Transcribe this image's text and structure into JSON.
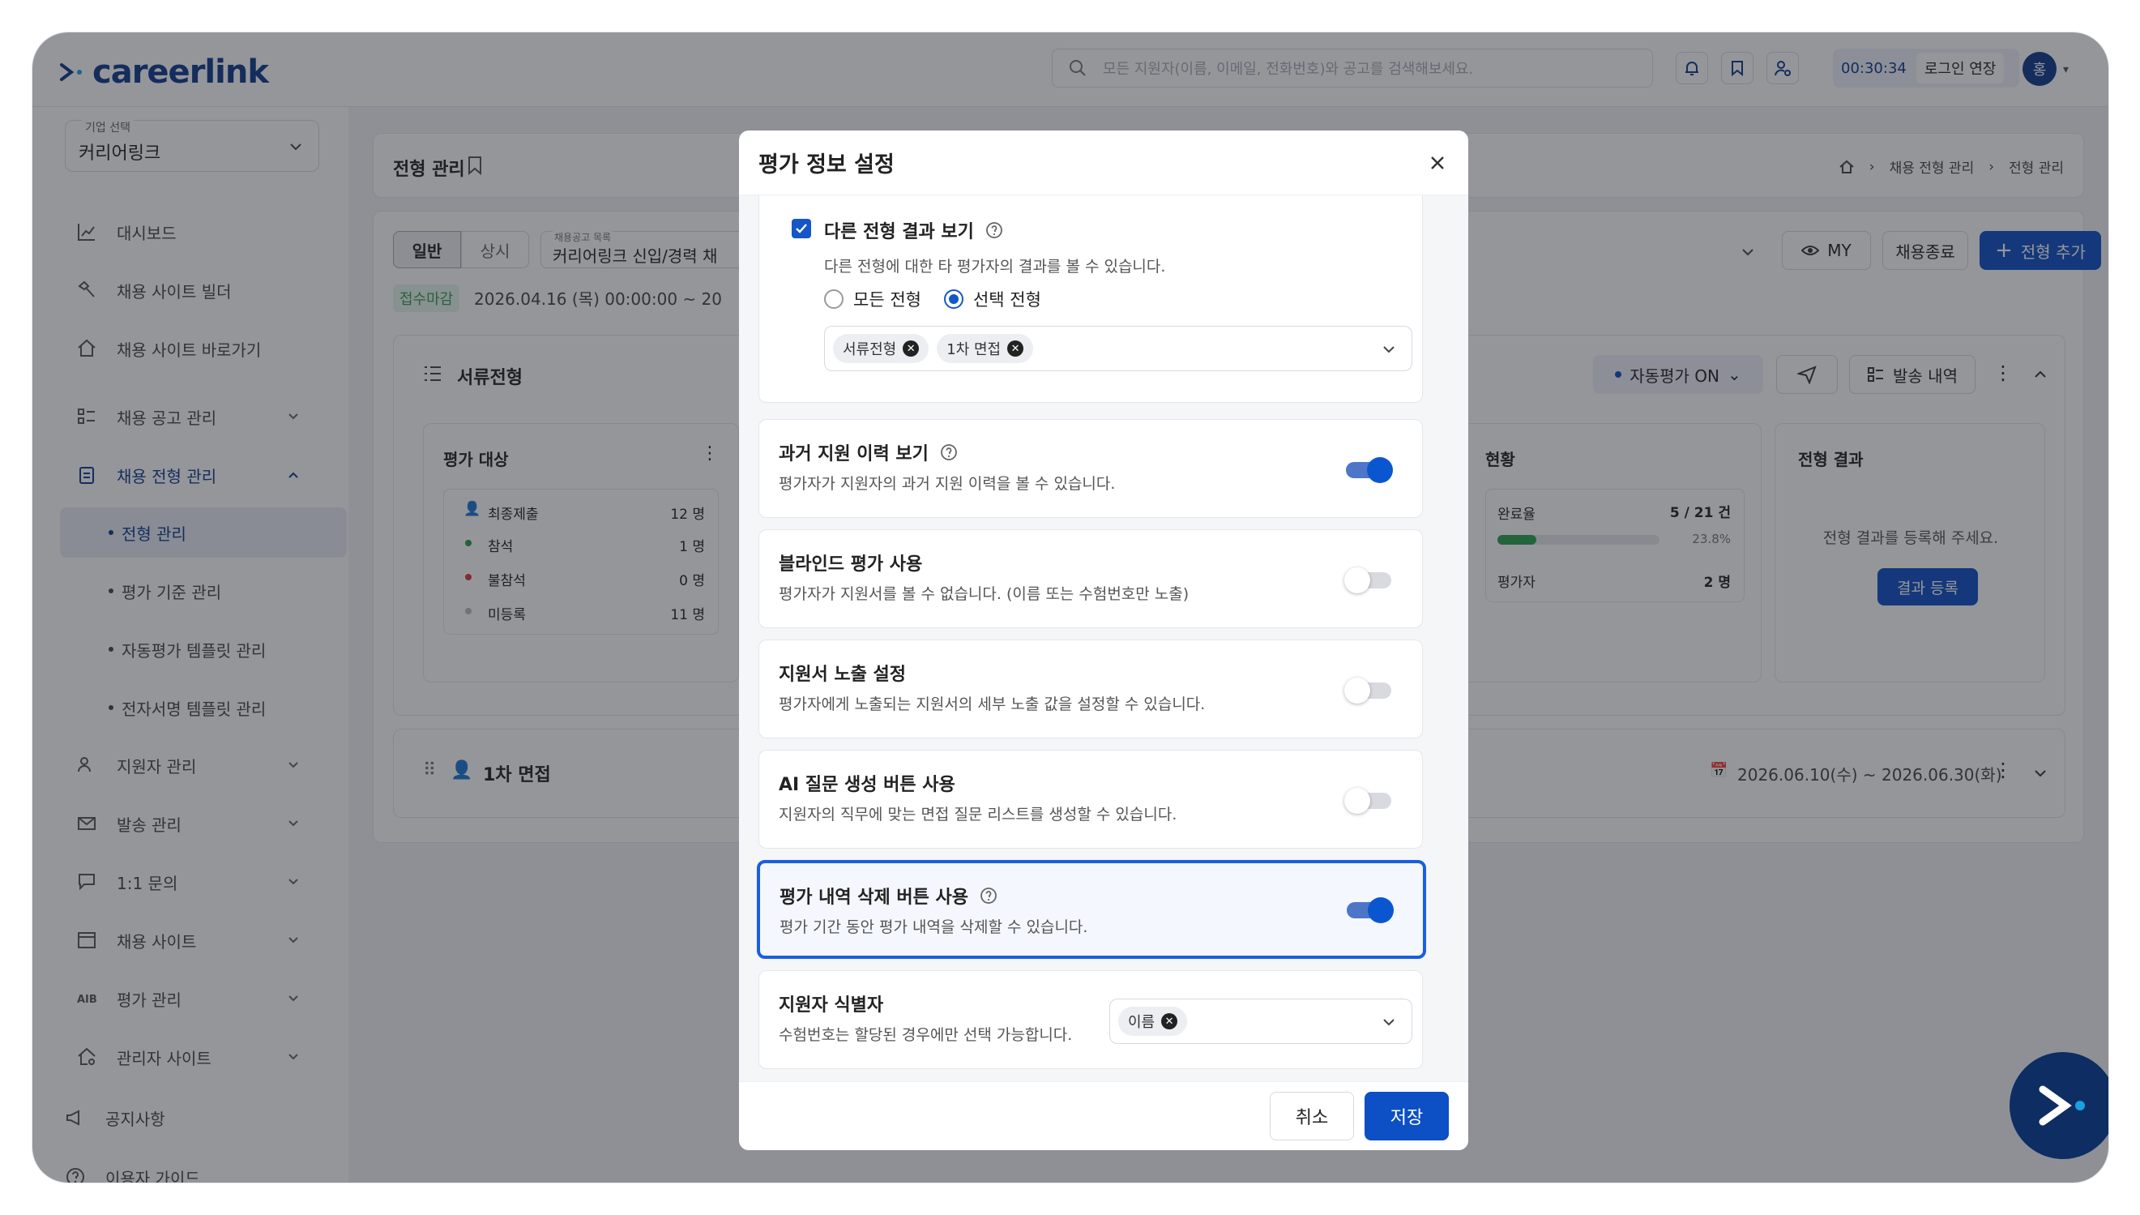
{
  "app": {
    "logo": "careerlink",
    "search_placeholder": "모든 지원자(이름, 이메일, 전화번호)와 공고를 검색해보세요.",
    "timer": "00:30:34",
    "extend_login": "로그인 연장",
    "avatar_initial": "홍"
  },
  "sidebar": {
    "company_label": "기업 선택",
    "company_value": "커리어링크",
    "items": [
      {
        "label": "대시보드"
      },
      {
        "label": "채용 사이트 빌더"
      },
      {
        "label": "채용 사이트 바로가기"
      },
      {
        "label": "채용 공고 관리"
      },
      {
        "label": "채용 전형 관리"
      },
      {
        "label": "지원자 관리"
      },
      {
        "label": "발송 관리"
      },
      {
        "label": "1:1 문의"
      },
      {
        "label": "채용 사이트"
      },
      {
        "label": "평가 관리"
      },
      {
        "label": "관리자 사이트"
      },
      {
        "label": "공지사항"
      },
      {
        "label": "이용자 가이드"
      }
    ],
    "sub_items": [
      {
        "label": "전형 관리"
      },
      {
        "label": "평가 기준 관리"
      },
      {
        "label": "자동평가 템플릿 관리"
      },
      {
        "label": "전자서명 템플릿 관리"
      }
    ]
  },
  "page": {
    "title": "전형 관리",
    "breadcrumb": [
      "채용 전형 관리",
      "전형 관리"
    ],
    "tab_general": "일반",
    "tab_always": "상시",
    "posting_label": "채용공고 목록",
    "posting_value": "커리어링크 신입/경력 채",
    "status_badge": "접수마감",
    "date_range": "2026.04.16 (목) 00:00:00 ~ 20",
    "my_label": "MY",
    "close_label": "채용종료",
    "add_stage": "전형 추가",
    "stage1_title": "서류전형",
    "auto_eval": "자동평가 ON",
    "send_history": "발송 내역",
    "target_title": "평가 대상",
    "target_rows": [
      {
        "label": "최종제출",
        "count": "12 명"
      },
      {
        "label": "참석",
        "count": "1 명"
      },
      {
        "label": "불참석",
        "count": "0 명"
      },
      {
        "label": "미등록",
        "count": "11 명"
      }
    ],
    "progress_title": "현황",
    "done_rate_label": "완료율",
    "done_rate_value": "5 / 21 건",
    "done_rate_pct": "23.8%",
    "evaluator_label": "평가자",
    "evaluator_value": "2 명",
    "result_title": "전형 결과",
    "result_desc": "전형 결과를 등록해 주세요.",
    "result_button": "결과 등록",
    "stage2_title": "1차 면접",
    "stage2_dates": "2026.06.10(수) ~ 2026.06.30(화)"
  },
  "modal": {
    "title": "평가 정보 설정",
    "other_results": {
      "title": "다른 전형 결과 보기",
      "desc": "다른 전형에 대한 타 평가자의 결과를 볼 수 있습니다.",
      "radio_all": "모든 전형",
      "radio_selected": "선택 전형",
      "chips": [
        "서류전형",
        "1차 면접"
      ]
    },
    "settings": [
      {
        "title": "과거 지원 이력 보기",
        "desc": "평가자가 지원자의 과거 지원 이력을 볼 수 있습니다."
      },
      {
        "title": "블라인드 평가 사용",
        "desc": "평가자가 지원서를 볼 수 없습니다. (이름 또는 수험번호만 노출)"
      },
      {
        "title": "지원서 노출 설정",
        "desc": "평가자에게 노출되는 지원서의 세부 노출 값을 설정할 수 있습니다."
      },
      {
        "title": "AI 질문 생성 버튼 사용",
        "desc": "지원자의 직무에 맞는 면접 질문 리스트를 생성할 수 있습니다."
      },
      {
        "title": "평가 내역 삭제 버튼 사용",
        "desc": "평가 기간 동안 평가 내역을 삭제할 수 있습니다."
      }
    ],
    "identifier": {
      "title": "지원자 식별자",
      "desc": "수험번호는 할당된 경우에만 선택 가능합니다.",
      "chip": "이름"
    },
    "cancel": "취소",
    "save": "저장"
  }
}
